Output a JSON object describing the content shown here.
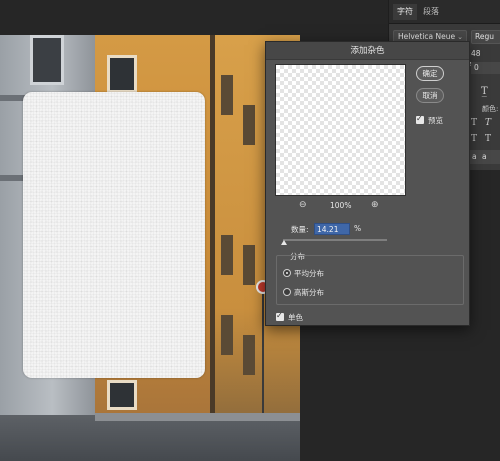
{
  "dialog": {
    "title": "添加杂色",
    "ok_label": "确定",
    "cancel_label": "取消",
    "preview_label": "预览",
    "preview_checked": true,
    "zoom_level": "100%",
    "amount_label": "数量:",
    "amount_value": "14.21",
    "amount_unit": "%",
    "distribution_label": "分布",
    "distribution_options": [
      {
        "label": "平均分布",
        "selected": true
      },
      {
        "label": "高斯分布",
        "selected": false
      }
    ],
    "monochromatic_label": "单色",
    "monochromatic_checked": true
  },
  "character_panel": {
    "tabs": [
      "字符",
      "段落"
    ],
    "active_tab": "字符",
    "font_family": "Helvetica Neue",
    "font_style": "Regu",
    "font_size": "48",
    "va_value": "0",
    "color_label": "颜色:",
    "aa_label": "a",
    "aa_value": "a"
  },
  "colors": {
    "dialog_bg": "#535353",
    "amount_highlight": "#3f67a8",
    "panel_bg": "#3a3a3a"
  }
}
